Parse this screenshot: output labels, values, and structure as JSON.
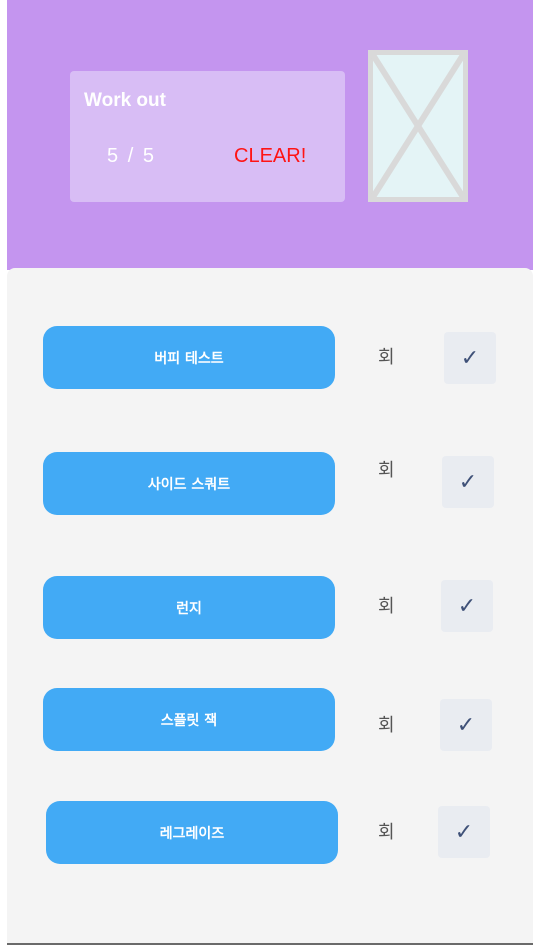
{
  "header": {
    "title": "Work out",
    "progress": {
      "done": "5",
      "separator": "/",
      "total": "5"
    },
    "status": "CLEAR!",
    "image_icon": "image-placeholder-icon"
  },
  "exercises": [
    {
      "name": "버피 테스트",
      "unit": "회",
      "check": "✓"
    },
    {
      "name": "사이드 스쿼트",
      "unit": "회",
      "check": "✓"
    },
    {
      "name": "런지",
      "unit": "회",
      "check": "✓"
    },
    {
      "name": "스플릿 잭",
      "unit": "회",
      "check": "✓"
    },
    {
      "name": "레그레이즈",
      "unit": "회",
      "check": "✓"
    }
  ],
  "colors": {
    "header_bg": "#c495ef",
    "card_bg": "#d8bdf5",
    "clear_text": "#ff1414",
    "button_bg": "#42aaf5",
    "check_bg": "#e9ecf1",
    "check_mark": "#3f5178",
    "content_bg": "#f4f4f4"
  }
}
